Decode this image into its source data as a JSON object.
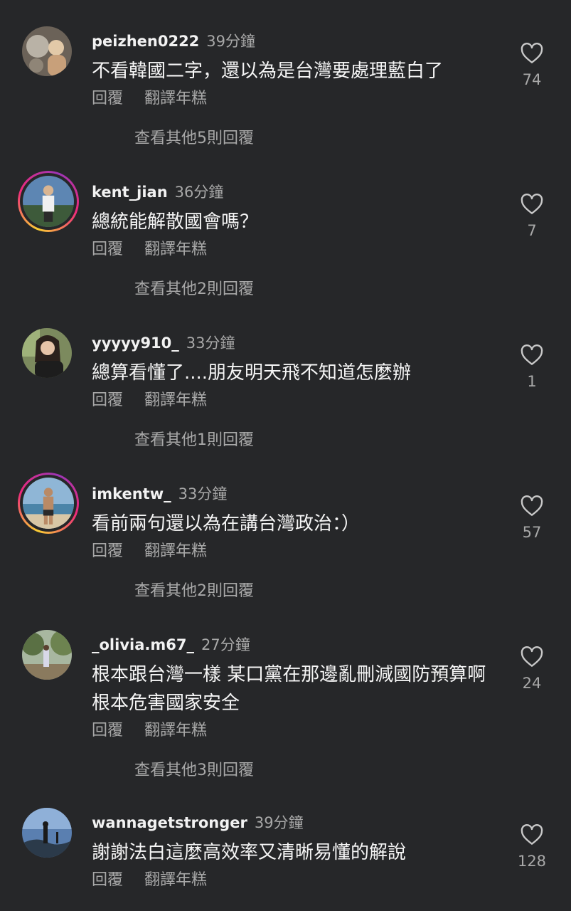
{
  "comments": [
    {
      "username": "peizhen0222",
      "time": "39分鐘",
      "text": "不看韓國二字，還以為是台灣要處理藍白了",
      "reply": "回覆",
      "translate": "翻譯年糕",
      "likes": "74",
      "view_replies": "查看其他5則回覆",
      "story_ring": false
    },
    {
      "username": "kent_jian",
      "time": "36分鐘",
      "text": "總統能解散國會嗎？",
      "reply": "回覆",
      "translate": "翻譯年糕",
      "likes": "7",
      "view_replies": "查看其他2則回覆",
      "story_ring": true
    },
    {
      "username": "yyyyy910_",
      "time": "33分鐘",
      "text": "總算看懂了....朋友明天飛不知道怎麼辦",
      "reply": "回覆",
      "translate": "翻譯年糕",
      "likes": "1",
      "view_replies": "查看其他1則回覆",
      "story_ring": false
    },
    {
      "username": "imkentw_",
      "time": "33分鐘",
      "text": "看前兩句還以為在講台灣政治：）",
      "reply": "回覆",
      "translate": "翻譯年糕",
      "likes": "57",
      "view_replies": "查看其他2則回覆",
      "story_ring": true
    },
    {
      "username": "_olivia.m67_",
      "time": "27分鐘",
      "text": "根本跟台灣一樣 某口黨在那邊亂刪減國防預算啊根本危害國家安全",
      "reply": "回覆",
      "translate": "翻譯年糕",
      "likes": "24",
      "view_replies": "查看其他3則回覆",
      "story_ring": false
    },
    {
      "username": "wannagetstronger",
      "time": "39分鐘",
      "text": "謝謝法白這麼高效率又清晰易懂的解說",
      "reply": "回覆",
      "translate": "翻譯年糕",
      "likes": "128",
      "view_replies": "",
      "story_ring": false
    }
  ]
}
